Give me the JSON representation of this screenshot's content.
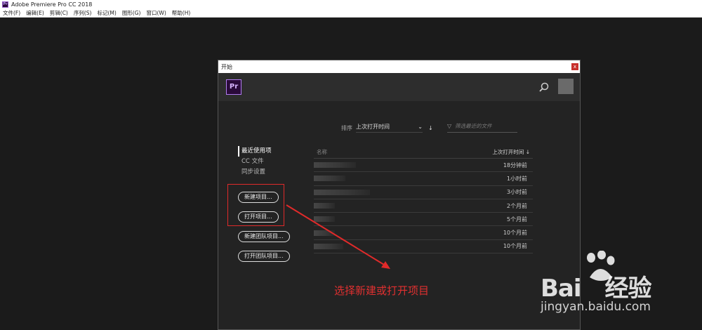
{
  "app": {
    "title": "Adobe Premiere Pro CC 2018",
    "icon_label": "Pr"
  },
  "menu": [
    "文件(F)",
    "编辑(E)",
    "剪辑(C)",
    "序列(S)",
    "标记(M)",
    "图形(G)",
    "窗口(W)",
    "帮助(H)"
  ],
  "dialog": {
    "title": "开始",
    "close": "x",
    "logo": "Pr",
    "sort": {
      "label": "排序",
      "value": "上次打开时间"
    },
    "filter_placeholder": "筛选最近的文件",
    "nav": [
      "最近使用项",
      "CC 文件",
      "同步设置"
    ],
    "buttons": {
      "new_project": "新建项目...",
      "open_project": "打开项目...",
      "new_team_project": "新建团队项目...",
      "open_team_project": "打开团队项目..."
    },
    "table": {
      "col_name": "名称",
      "col_time": "上次打开时间",
      "rows": [
        "18分钟前",
        "1小时前",
        "3小时前",
        "2个月前",
        "5个月前",
        "10个月前",
        "10个月前"
      ]
    }
  },
  "annotation": {
    "caption": "选择新建或打开项目",
    "color": "#e03030"
  },
  "watermark": {
    "brand_left": "Bai",
    "brand_right": "经验",
    "url": "jingyan.baidu.com"
  }
}
